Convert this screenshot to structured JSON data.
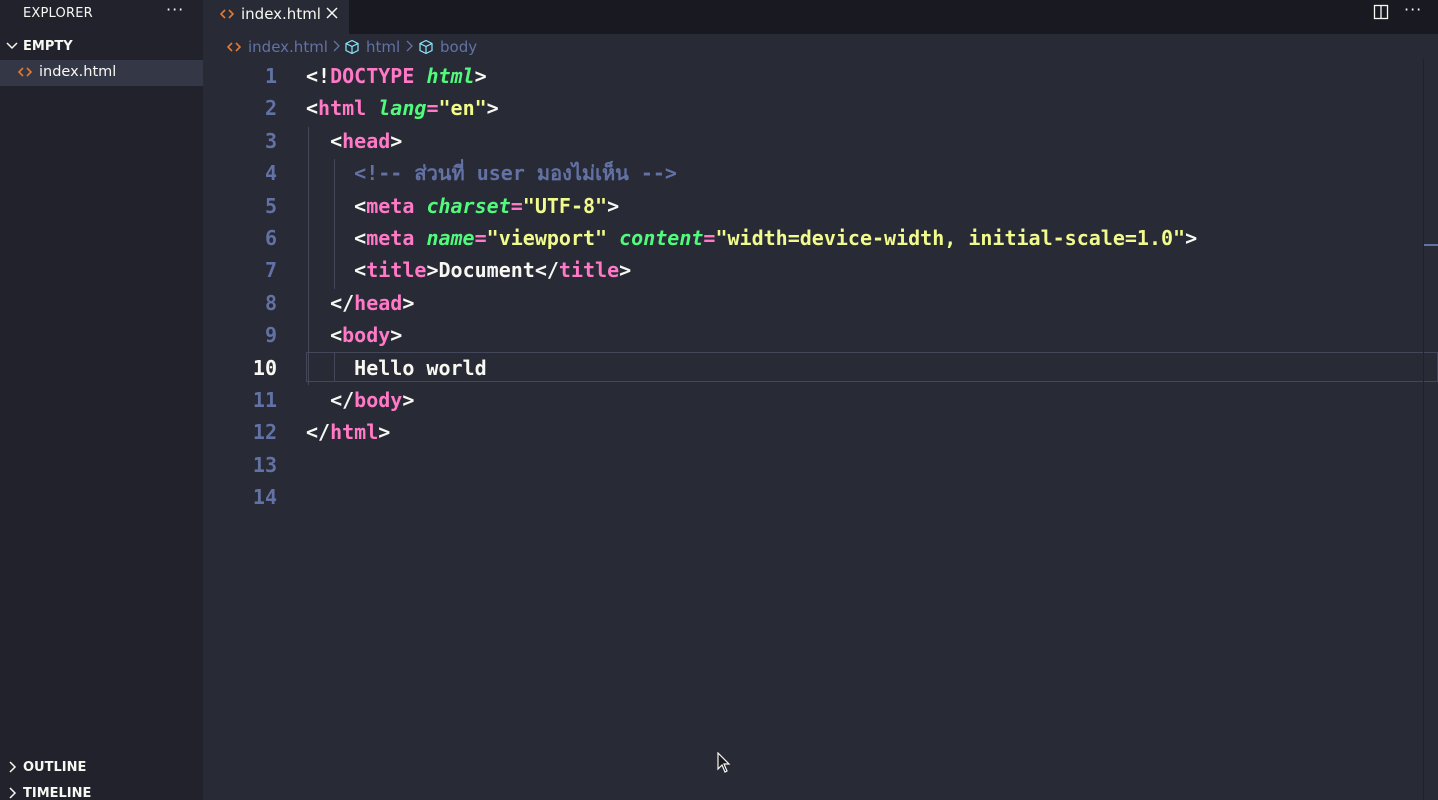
{
  "sidebar": {
    "title": "EXPLORER",
    "more_icon": "ellipsis-icon",
    "sections": {
      "folder": {
        "label": "EMPTY",
        "expanded": true
      },
      "outline": {
        "label": "OUTLINE",
        "expanded": false
      },
      "timeline": {
        "label": "TIMELINE",
        "expanded": false
      }
    },
    "files": [
      {
        "name": "index.html",
        "icon": "html-file-icon",
        "selected": true
      }
    ]
  },
  "tabs": [
    {
      "label": "index.html",
      "icon": "html-file-icon",
      "active": true
    }
  ],
  "tab_actions": {
    "split": "split-editor-icon",
    "more": "ellipsis-icon"
  },
  "breadcrumb": {
    "file": "index.html",
    "items": [
      "html",
      "body"
    ]
  },
  "editor": {
    "active_line": 10,
    "line_numbers": [
      "1",
      "2",
      "3",
      "4",
      "5",
      "6",
      "7",
      "8",
      "9",
      "10",
      "11",
      "12",
      "13",
      "14"
    ],
    "lines": [
      {
        "tokens": [
          {
            "t": "punc",
            "v": "<!"
          },
          {
            "t": "tag",
            "v": "DOCTYPE"
          },
          {
            "t": "punc",
            "v": " "
          },
          {
            "t": "attr",
            "v": "html"
          },
          {
            "t": "punc",
            "v": ">"
          }
        ]
      },
      {
        "tokens": [
          {
            "t": "punc",
            "v": "<"
          },
          {
            "t": "tag",
            "v": "html"
          },
          {
            "t": "punc",
            "v": " "
          },
          {
            "t": "attr",
            "v": "lang"
          },
          {
            "t": "tag",
            "v": "="
          },
          {
            "t": "str",
            "v": "\"en\""
          },
          {
            "t": "punc",
            "v": ">"
          }
        ]
      },
      {
        "tokens": [
          {
            "t": "punc",
            "v": "  <"
          },
          {
            "t": "tag",
            "v": "head"
          },
          {
            "t": "punc",
            "v": ">"
          }
        ]
      },
      {
        "tokens": [
          {
            "t": "cmt",
            "v": "    <!-- ส่วนที่ user มองไม่เห็น -->"
          }
        ]
      },
      {
        "tokens": [
          {
            "t": "punc",
            "v": "    <"
          },
          {
            "t": "tag",
            "v": "meta"
          },
          {
            "t": "punc",
            "v": " "
          },
          {
            "t": "attr",
            "v": "charset"
          },
          {
            "t": "tag",
            "v": "="
          },
          {
            "t": "str",
            "v": "\"UTF-8\""
          },
          {
            "t": "punc",
            "v": ">"
          }
        ]
      },
      {
        "tokens": [
          {
            "t": "punc",
            "v": "    <"
          },
          {
            "t": "tag",
            "v": "meta"
          },
          {
            "t": "punc",
            "v": " "
          },
          {
            "t": "attr",
            "v": "name"
          },
          {
            "t": "tag",
            "v": "="
          },
          {
            "t": "str",
            "v": "\"viewport\""
          },
          {
            "t": "punc",
            "v": " "
          },
          {
            "t": "attr",
            "v": "content"
          },
          {
            "t": "tag",
            "v": "="
          },
          {
            "t": "str",
            "v": "\"width=device-width, initial-scale=1.0\""
          },
          {
            "t": "punc",
            "v": ">"
          }
        ]
      },
      {
        "tokens": [
          {
            "t": "punc",
            "v": "    <"
          },
          {
            "t": "tag",
            "v": "title"
          },
          {
            "t": "punc",
            "v": ">"
          },
          {
            "t": "text",
            "v": "Document"
          },
          {
            "t": "punc",
            "v": "</"
          },
          {
            "t": "tag",
            "v": "title"
          },
          {
            "t": "punc",
            "v": ">"
          }
        ]
      },
      {
        "tokens": [
          {
            "t": "punc",
            "v": "  </"
          },
          {
            "t": "tag",
            "v": "head"
          },
          {
            "t": "punc",
            "v": ">"
          }
        ]
      },
      {
        "tokens": [
          {
            "t": "punc",
            "v": "  <"
          },
          {
            "t": "tag",
            "v": "body"
          },
          {
            "t": "punc",
            "v": ">"
          }
        ]
      },
      {
        "tokens": [
          {
            "t": "text",
            "v": "    Hello world"
          }
        ]
      },
      {
        "tokens": [
          {
            "t": "punc",
            "v": "  </"
          },
          {
            "t": "tag",
            "v": "body"
          },
          {
            "t": "punc",
            "v": ">"
          }
        ]
      },
      {
        "tokens": [
          {
            "t": "punc",
            "v": "</"
          },
          {
            "t": "tag",
            "v": "html"
          },
          {
            "t": "punc",
            "v": ">"
          }
        ]
      },
      {
        "tokens": []
      },
      {
        "tokens": []
      }
    ]
  },
  "colors": {
    "background": "#282a36",
    "sidebar": "#21222c",
    "tag": "#ff79c6",
    "attribute": "#50fa7b",
    "string": "#f1fa8c",
    "comment": "#6272a4",
    "foreground": "#f8f8f2"
  }
}
